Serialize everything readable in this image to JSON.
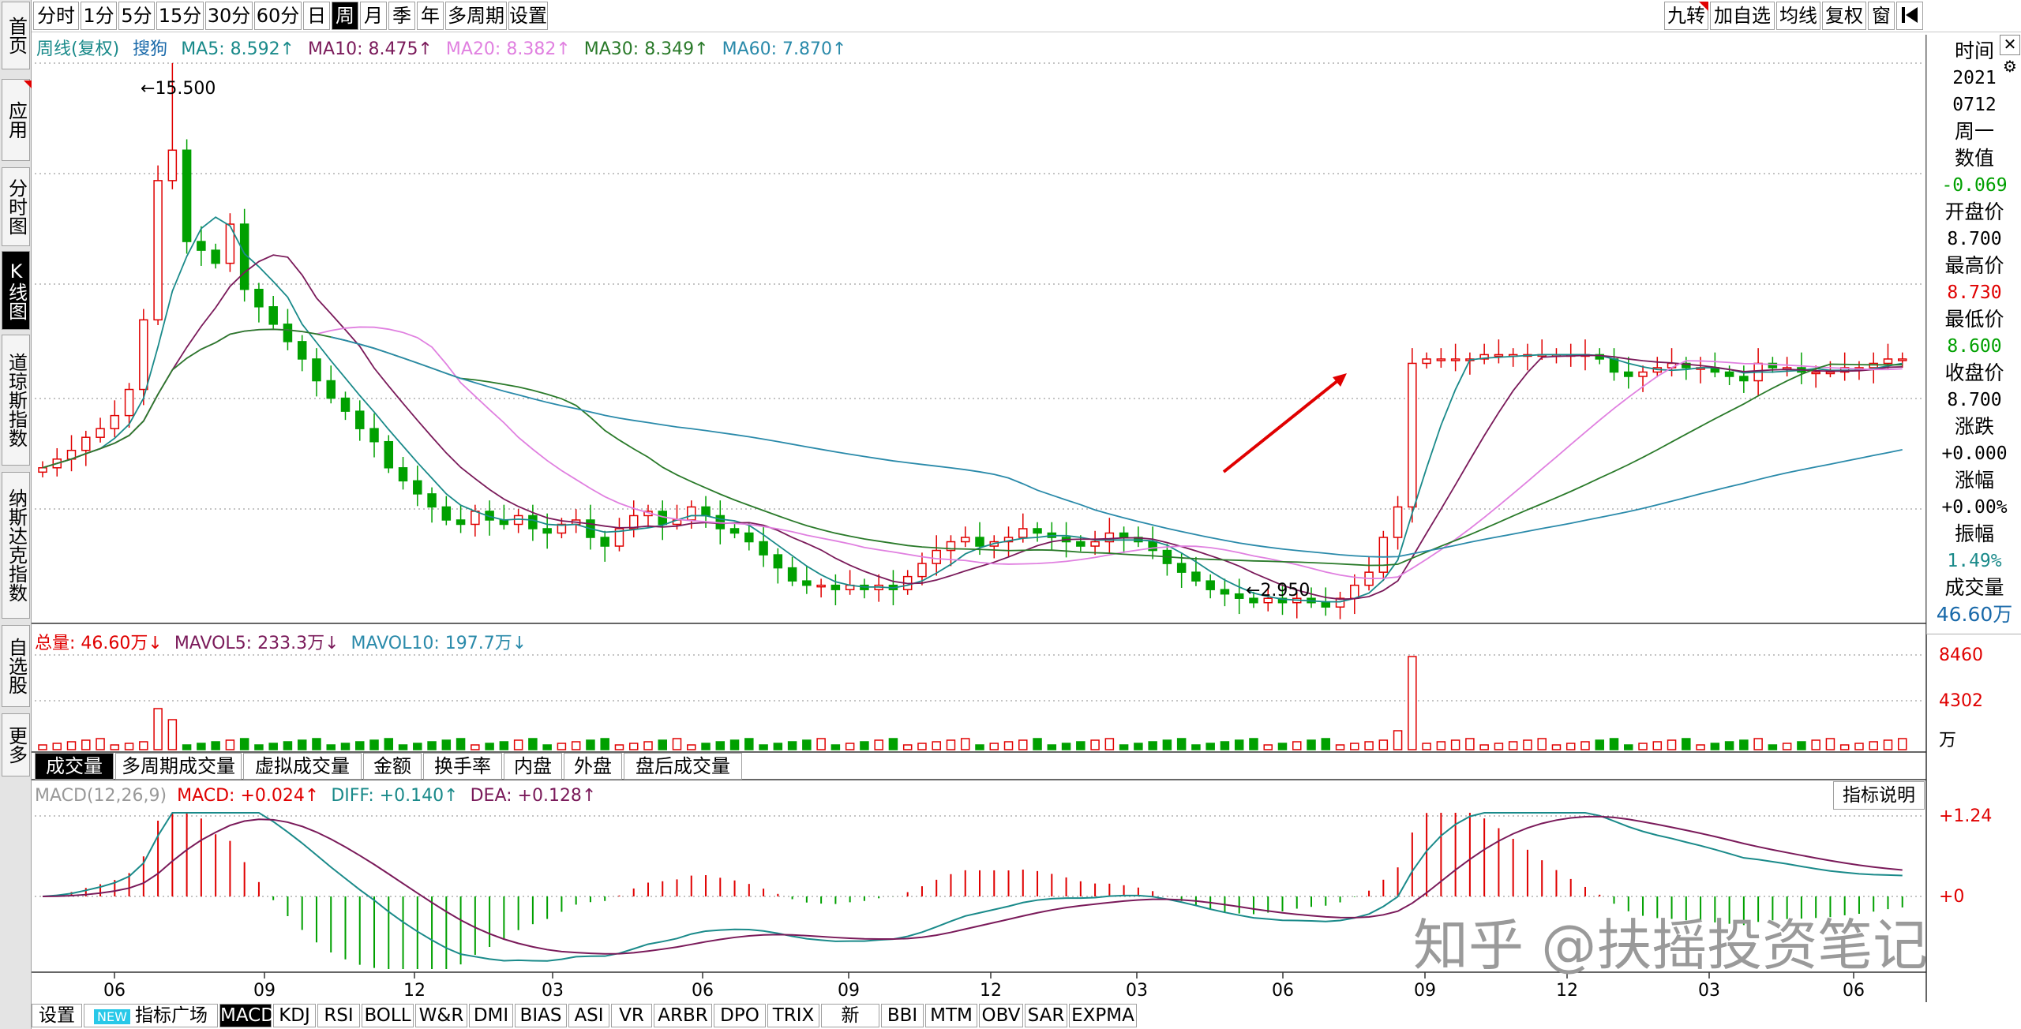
{
  "period_toolbar": [
    {
      "label": "分时",
      "active": false
    },
    {
      "label": "1分",
      "active": false
    },
    {
      "label": "5分",
      "active": false
    },
    {
      "label": "15分",
      "active": false
    },
    {
      "label": "30分",
      "active": false
    },
    {
      "label": "60分",
      "active": false
    },
    {
      "label": "日",
      "active": false
    },
    {
      "label": "周",
      "active": true
    },
    {
      "label": "月",
      "active": false
    },
    {
      "label": "季",
      "active": false
    },
    {
      "label": "年",
      "active": false
    },
    {
      "label": "多周期",
      "active": false
    },
    {
      "label": "设置",
      "active": false
    }
  ],
  "right_toolbar": {
    "jiuzhuan": "九转",
    "add_watch": "加自选",
    "ma_line": "均线",
    "fuquan": "复权",
    "window": "窗",
    "back_icon": "back-to-start-icon"
  },
  "sidebar": {
    "home": "首页",
    "app": "应用",
    "minute_chart": "分时图",
    "kline_chart": "K线图",
    "dow_jones": "道琼斯指数",
    "nasdaq": "纳斯达克指数",
    "watchlist": "自选股",
    "more": "更多"
  },
  "ma_legend": {
    "title": "周线(复权)",
    "stock": "搜狗",
    "ma5": "MA5: 8.592",
    "ma10": "MA10: 8.475",
    "ma20": "MA20: 8.382",
    "ma30": "MA30: 8.349",
    "ma60": "MA60: 7.870"
  },
  "price_annotations": {
    "high": "15.500",
    "low": "2.950"
  },
  "volume_legend": {
    "total": "总量: 46.60万",
    "mavol5": "MAVOL5: 233.3万",
    "mavol10": "MAVOL10: 197.7万"
  },
  "volume_axis": {
    "top": "8460",
    "mid": "4302",
    "unit": "万"
  },
  "volume_tabs": [
    {
      "label": "成交量",
      "active": true
    },
    {
      "label": "多周期成交量",
      "active": false
    },
    {
      "label": "虚拟成交量",
      "active": false
    },
    {
      "label": "金额",
      "active": false
    },
    {
      "label": "换手率",
      "active": false
    },
    {
      "label": "内盘",
      "active": false
    },
    {
      "label": "外盘",
      "active": false
    },
    {
      "label": "盘后成交量",
      "active": false
    }
  ],
  "macd_legend": {
    "name": "MACD(12,26,9)",
    "macd": "MACD: +0.024",
    "diff": "DIFF: +0.140",
    "dea": "DEA: +0.128"
  },
  "macd_axis": {
    "top": "+1.24",
    "zero": "+0"
  },
  "indicator_help": "指标说明",
  "x_axis_labels": [
    "06",
    "09",
    "12",
    "03",
    "06",
    "09",
    "12",
    "03",
    "06",
    "09",
    "12",
    "03",
    "06"
  ],
  "right_panel": {
    "time_label": "时间",
    "year": "2021",
    "date": "0712",
    "weekday": "周一",
    "value_label": "数值",
    "value": "-0.069",
    "open_label": "开盘价",
    "open": "8.700",
    "high_label": "最高价",
    "high": "8.730",
    "low_label": "最低价",
    "low": "8.600",
    "close_label": "收盘价",
    "close": "8.700",
    "change_label": "涨跌",
    "change": "+0.000",
    "pct_label": "涨幅",
    "pct": "+0.00%",
    "amp_label": "振幅",
    "amp": "1.49%",
    "vol_label": "成交量",
    "vol": "46.60万"
  },
  "bottom_tabs": [
    {
      "label": "设置",
      "active": false
    },
    {
      "label": "指标广场",
      "active": false,
      "badge": "NEW"
    },
    {
      "label": "MACD",
      "active": true
    },
    {
      "label": "KDJ",
      "active": false
    },
    {
      "label": "RSI",
      "active": false
    },
    {
      "label": "BOLL",
      "active": false
    },
    {
      "label": "W&R",
      "active": false
    },
    {
      "label": "DMI",
      "active": false
    },
    {
      "label": "BIAS",
      "active": false
    },
    {
      "label": "ASI",
      "active": false
    },
    {
      "label": "VR",
      "active": false
    },
    {
      "label": "ARBR",
      "active": false
    },
    {
      "label": "DPO",
      "active": false
    },
    {
      "label": "TRIX",
      "active": false
    },
    {
      "label": "新DMA",
      "active": false
    },
    {
      "label": "BBI",
      "active": false
    },
    {
      "label": "MTM",
      "active": false
    },
    {
      "label": "OBV",
      "active": false
    },
    {
      "label": "SAR",
      "active": false
    },
    {
      "label": "EXPMA",
      "active": false
    }
  ],
  "watermark": "知乎 @扶摇投资笔记",
  "colors": {
    "up": "#e00000",
    "down": "#00a000",
    "ma5": "#1a8a8a",
    "ma10": "#7a1a5a",
    "ma20": "#e080e0",
    "ma30": "#2a7a2a",
    "ma60": "#2a8aaa",
    "grid": "#888888"
  },
  "chart_data": {
    "type": "candlestick",
    "price_range": [
      2.95,
      15.5
    ],
    "weekly_closes": [
      6.2,
      6.4,
      6.6,
      6.9,
      7.1,
      7.4,
      8.0,
      9.6,
      12.8,
      13.5,
      11.4,
      11.2,
      10.9,
      11.8,
      10.3,
      9.9,
      9.5,
      9.1,
      8.7,
      8.2,
      7.8,
      7.5,
      7.1,
      6.8,
      6.2,
      5.9,
      5.6,
      5.3,
      5.0,
      4.9,
      5.2,
      5.0,
      4.9,
      5.1,
      4.8,
      4.7,
      4.9,
      5.0,
      4.6,
      4.4,
      4.8,
      5.1,
      5.2,
      4.9,
      5.0,
      5.3,
      5.1,
      4.8,
      4.7,
      4.5,
      4.2,
      3.9,
      3.6,
      3.5,
      3.5,
      3.4,
      3.5,
      3.4,
      3.5,
      3.4,
      3.7,
      4.0,
      4.3,
      4.5,
      4.6,
      4.4,
      4.5,
      4.6,
      4.8,
      4.7,
      4.6,
      4.5,
      4.4,
      4.5,
      4.7,
      4.6,
      4.5,
      4.3,
      4.0,
      3.8,
      3.6,
      3.4,
      3.3,
      3.2,
      3.1,
      3.2,
      3.1,
      3.2,
      3.1,
      3.0,
      3.2,
      3.5,
      3.8,
      4.6,
      5.3,
      8.6,
      8.7,
      8.7,
      8.7,
      8.7,
      8.8,
      8.8,
      8.8,
      8.8,
      8.8,
      8.8,
      8.8,
      8.8,
      8.7,
      8.4,
      8.3,
      8.4,
      8.5,
      8.6,
      8.5,
      8.5,
      8.4,
      8.3,
      8.2,
      8.6,
      8.5,
      8.5,
      8.4,
      8.4,
      8.4,
      8.5,
      8.5,
      8.6,
      8.7,
      8.7
    ],
    "ma5": 8.592,
    "ma10": 8.475,
    "ma20": 8.382,
    "ma30": 8.349,
    "ma60": 7.87,
    "volume_range": [
      0,
      8460
    ],
    "macd_range": [
      -0.5,
      1.24
    ]
  }
}
